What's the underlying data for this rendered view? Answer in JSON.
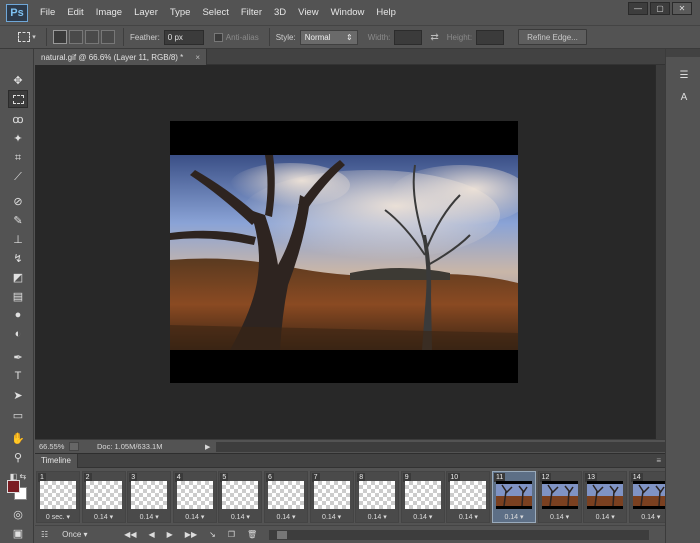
{
  "app": {
    "logo": "Ps"
  },
  "menu": [
    "File",
    "Edit",
    "Image",
    "Layer",
    "Type",
    "Select",
    "Filter",
    "3D",
    "View",
    "Window",
    "Help"
  ],
  "options_bar": {
    "feather_label": "Feather:",
    "feather_value": "0 px",
    "antialias_label": "Anti-alias",
    "style_label": "Style:",
    "style_value": "Normal",
    "width_label": "Width:",
    "height_label": "Height:",
    "refine_label": "Refine Edge..."
  },
  "document_tab": {
    "title": "natural.gif @ 66.6% (Layer 11, RGB/8) *",
    "close": "×"
  },
  "status_bar": {
    "zoom": "66.55%",
    "doc_info": "Doc: 1.05M/633.1M"
  },
  "timeline": {
    "title": "Timeline",
    "loop": "Once",
    "frames": [
      {
        "num": "1",
        "delay": "0 sec.",
        "thumb": "transparent"
      },
      {
        "num": "2",
        "delay": "0.14",
        "thumb": "transparent"
      },
      {
        "num": "3",
        "delay": "0.14",
        "thumb": "transparent"
      },
      {
        "num": "4",
        "delay": "0.14",
        "thumb": "transparent"
      },
      {
        "num": "5",
        "delay": "0.14",
        "thumb": "transparent"
      },
      {
        "num": "6",
        "delay": "0.14",
        "thumb": "transparent"
      },
      {
        "num": "7",
        "delay": "0.14",
        "thumb": "transparent"
      },
      {
        "num": "8",
        "delay": "0.14",
        "thumb": "transparent"
      },
      {
        "num": "9",
        "delay": "0.14",
        "thumb": "transparent"
      },
      {
        "num": "10",
        "delay": "0.14",
        "thumb": "transparent"
      },
      {
        "num": "11",
        "delay": "0.14",
        "thumb": "image",
        "selected": true
      },
      {
        "num": "12",
        "delay": "0.14",
        "thumb": "image"
      },
      {
        "num": "13",
        "delay": "0.14",
        "thumb": "image"
      },
      {
        "num": "14",
        "delay": "0.14",
        "thumb": "image"
      }
    ]
  },
  "colors": {
    "foreground": "#7a1c22",
    "background": "#ffffff",
    "canvas_bg": "#282828",
    "ui_bg": "#535353"
  }
}
